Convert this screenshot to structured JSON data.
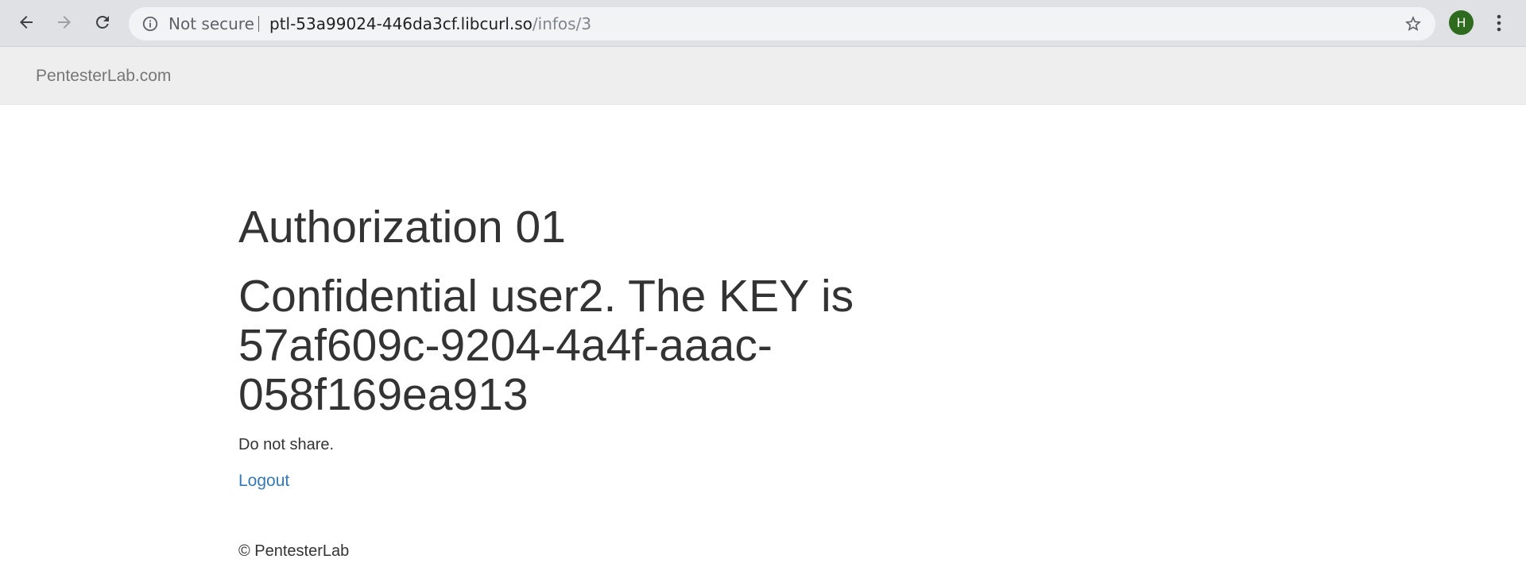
{
  "browser": {
    "security_label": "Not secure",
    "url_host": "ptl-53a99024-446da3cf.libcurl.so",
    "url_path": "/infos/3",
    "profile_initial": "H",
    "colors": {
      "avatar": "#2e6b1f",
      "toolbar": "#dfe1e5",
      "omnibox": "#f1f3f4"
    }
  },
  "navbar": {
    "brand": "PentesterLab.com"
  },
  "main": {
    "title": "Authorization 01",
    "secret_message": "Confidential user2. The KEY is 57af609c-9204-4a4f-aaac-058f169ea913",
    "note": "Do not share.",
    "logout_label": "Logout",
    "link_color": "#337ab7"
  },
  "footer": {
    "text": "© PentesterLab"
  }
}
